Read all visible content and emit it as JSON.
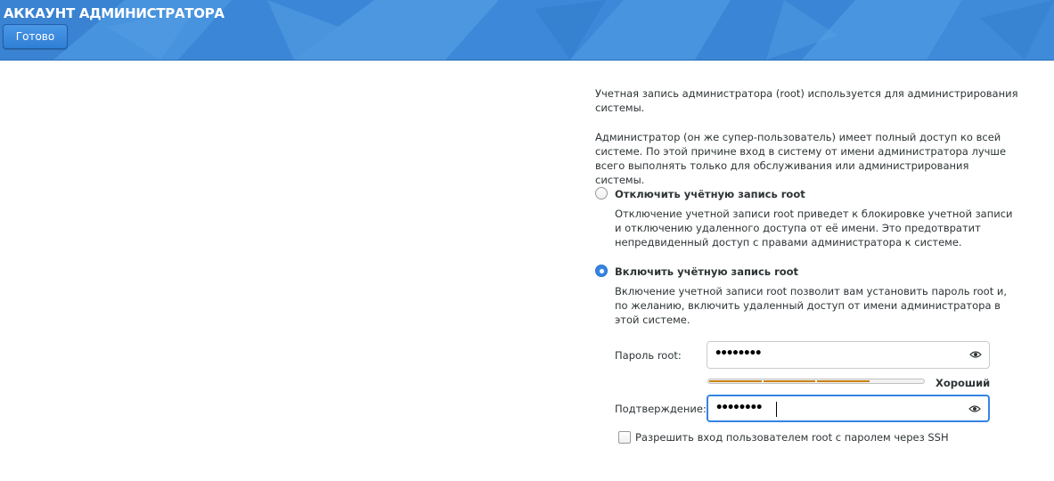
{
  "header": {
    "title": "АККАУНТ АДМИНИСТРАТОРА",
    "done_label": "Готово"
  },
  "intro": {
    "paragraph1": "Учетная запись администратора (root) используется для администрирования системы.",
    "paragraph2": "Администратор (он же супер-пользователь) имеет полный доступ ко всей системе. По этой причине вход в систему от имени администратора лучше всего выполнять только для обслуживания или администрирования системы."
  },
  "options": [
    {
      "label": "Отключить учётную запись root",
      "description": "Отключение учетной записи root приведет к блокировке учетной записи и отключению удаленного доступа от её имени. Это предотвратит непредвиденный доступ с правами администратора к системе.",
      "selected": false
    },
    {
      "label": "Включить учётную запись root",
      "description": "Включение учетной записи root позволит вам установить пароль root и, по желанию, включить удаленный доступ от имени администратора в этой системе.",
      "selected": true
    }
  ],
  "password": {
    "label": "Пароль root:",
    "value": "••••••••",
    "eye_icon": "eye-icon"
  },
  "strength": {
    "label": "Хороший",
    "level": 0.75,
    "color": "#c98113"
  },
  "confirm": {
    "label": "Подтверждение:",
    "value": "••••••••",
    "eye_icon": "eye-icon"
  },
  "ssh": {
    "label": "Разрешить вход пользователем root с паролем через SSH",
    "checked": false
  },
  "colors": {
    "header_bg": "#3f8ad8",
    "accent": "#3584e4"
  }
}
